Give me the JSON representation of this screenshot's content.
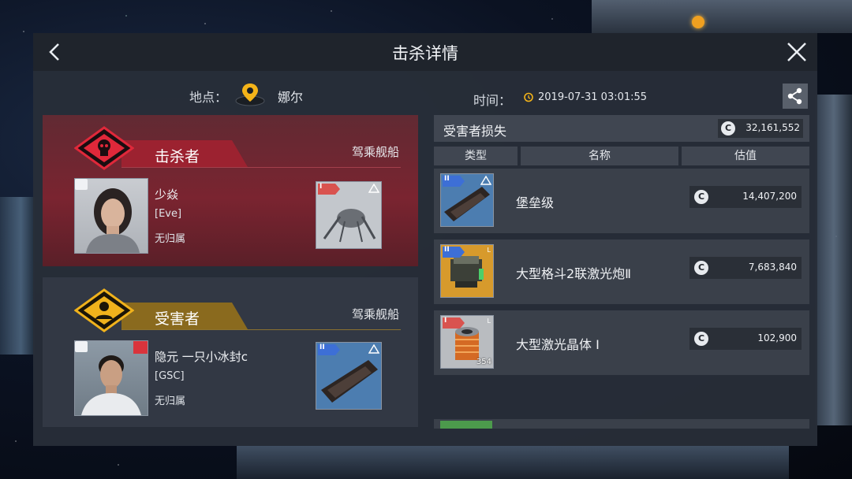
{
  "header": {
    "title": "击杀详情"
  },
  "location": {
    "label": "地点：",
    "value": "娜尔"
  },
  "time": {
    "label": "时间：",
    "value": "2019-07-31 03:01:55"
  },
  "killer": {
    "role_label": "击杀者",
    "ship_heading": "驾乘舰船",
    "pilot_name": "少焱",
    "corp": "[Eve]",
    "alliance": "无归属",
    "ship_tier": "I"
  },
  "victim": {
    "role_label": "受害者",
    "ship_heading": "驾乘舰船",
    "pilot_name": "隐元 一只小冰封c",
    "corp": "[GSC]",
    "alliance": "无归属",
    "ship_tier": "II"
  },
  "losses": {
    "title": "受害者损失",
    "currency_symbol": "C",
    "total": "32,161,552",
    "columns": [
      "类型",
      "名称",
      "估值"
    ],
    "items": [
      {
        "tier": "II",
        "name": "堡垒级",
        "value": "14,407,200",
        "slot": "",
        "quantity": ""
      },
      {
        "tier": "II",
        "name": "大型格斗2联激光炮Ⅱ",
        "value": "7,683,840",
        "slot": "L",
        "quantity": ""
      },
      {
        "tier": "I",
        "name": "大型激光晶体 I",
        "value": "102,900",
        "slot": "L",
        "quantity": "354"
      }
    ]
  },
  "colors": {
    "killer_accent": "#e0283a",
    "victim_accent": "#f0b21c",
    "tier1": "#d9534f",
    "tier2": "#3d6fd6"
  }
}
